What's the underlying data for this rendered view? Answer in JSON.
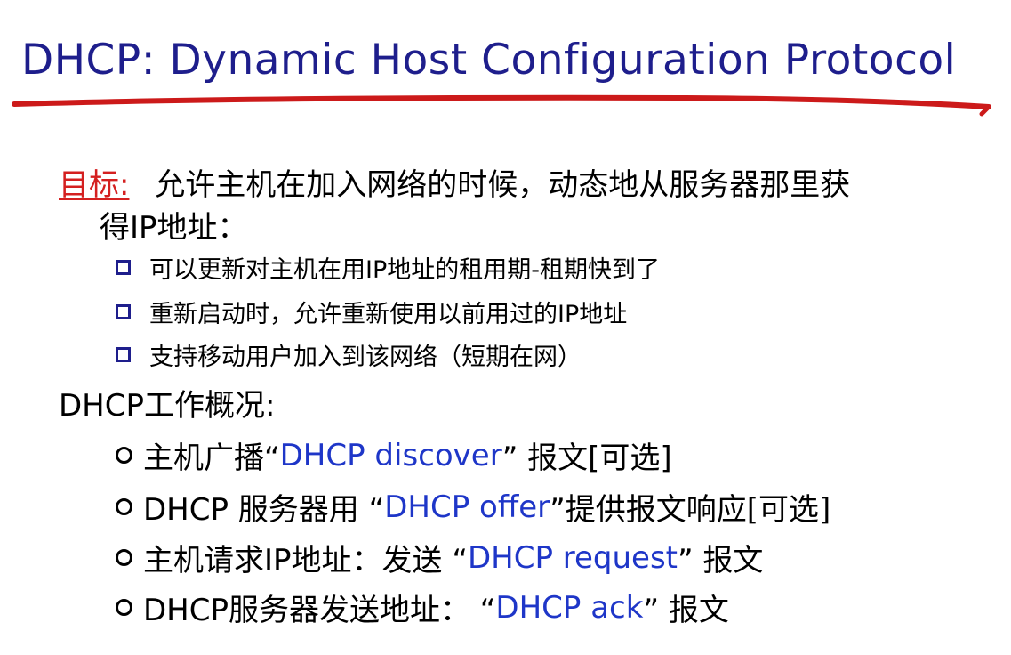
{
  "title": "DHCP: Dynamic Host Configuration Protocol",
  "goal": {
    "label": "目标:",
    "text_line1": "允许主机在加入网络的时候，动态地从服务器那里获",
    "text_line2": "得IP地址：",
    "subitems": [
      "可以更新对主机在用IP地址的租用期-租期快到了",
      "重新启动时，允许重新使用以前用过的IP地址",
      "支持移动用户加入到该网络（短期在网）"
    ]
  },
  "overview": {
    "heading": "DHCP工作概况:",
    "steps": [
      {
        "before": "主机广播“",
        "message": "DHCP discover",
        "after": "” 报文[可选]"
      },
      {
        "before": "DHCP 服务器用 “",
        "message": "DHCP offer",
        "after": "”提供报文响应[可选]"
      },
      {
        "before": "主机请求IP地址：发送 “",
        "message": "DHCP request",
        "after": "” 报文"
      },
      {
        "before": "DHCP服务器发送地址： “",
        "message": "DHCP ack",
        "after": "” 报文"
      }
    ]
  },
  "colors": {
    "title": "#1e1e8c",
    "underline": "#cc1a1a",
    "goal_label": "#d42020",
    "message_name": "#1e36c8"
  }
}
